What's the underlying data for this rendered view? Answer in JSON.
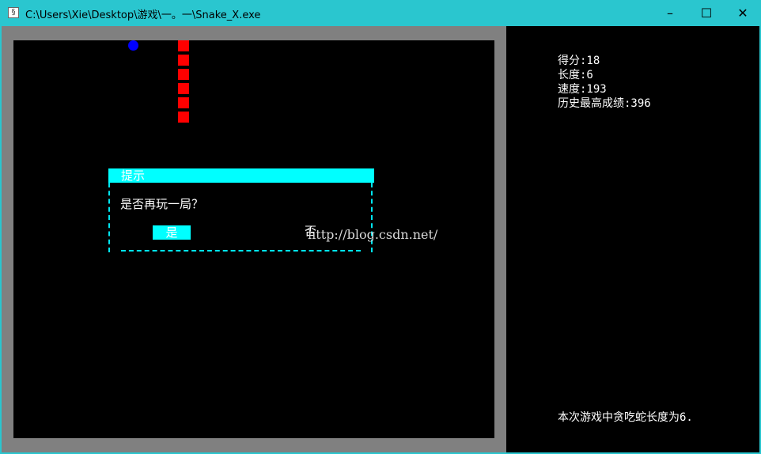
{
  "window": {
    "title": "C:\\Users\\Xie\\Desktop\\游戏\\一。一\\Snake_X.exe",
    "app_icon": "snake-app-icon",
    "controls": {
      "minimize": "–",
      "maximize": "☐",
      "close": "✕"
    }
  },
  "game": {
    "snake_color": "#ff0000",
    "food_color": "#0000ff",
    "snake_segments": 6
  },
  "dialog": {
    "title": "提示",
    "message": "是否再玩一局？",
    "yes_label": "是",
    "no_label": "否",
    "accent_color": "#00ffff"
  },
  "stats": {
    "score": "得分:18",
    "length": "长度:6",
    "speed": "速度:193",
    "best": "历史最高成绩:396"
  },
  "footer": {
    "message": "本次游戏中贪吃蛇长度为6."
  },
  "watermark": "http://blog.csdn.net/"
}
